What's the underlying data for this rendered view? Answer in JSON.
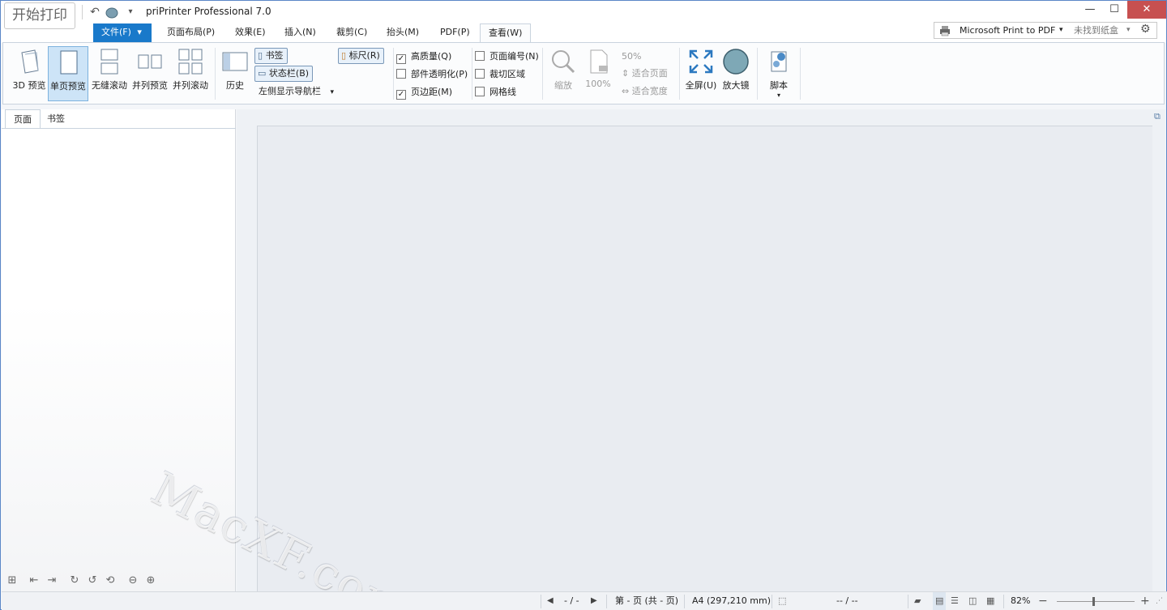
{
  "titlebar": {
    "start_print": "开始打印",
    "app_title": "priPrinter Professional 7.0",
    "undo_icon": "↶",
    "qat_dropdown_icon": "▾",
    "minimize_icon": "—",
    "maximize_icon": "☐",
    "close_icon": "✕"
  },
  "tabs": {
    "file": "文件(F)",
    "file_arrow": "▾",
    "page_layout": "页面布局(P)",
    "effects": "效果(E)",
    "insert": "插入(N)",
    "crop": "裁剪(C)",
    "header": "抬头(M)",
    "pdf": "PDF(P)",
    "view": "查看(W)"
  },
  "printer": {
    "name": "Microsoft Print to PDF",
    "tray": "未找到纸盒",
    "dropdown_icon": "▾",
    "settings_icon": "⚙"
  },
  "ribbon": {
    "preview_3d": "3D 预览",
    "single_page": "单页预览",
    "seamless_scroll": "无缝滚动",
    "side_by_side": "并列预览",
    "side_scroll": "并列滚动",
    "history": "历史",
    "bookmarks": "书签",
    "statusbar": "状态栏(B)",
    "left_nav": "左侧显示导航栏",
    "left_nav_arrow": "▾",
    "ruler": "标尺(R)",
    "high_quality": "高质量(Q)",
    "part_transparency": "部件透明化(P)",
    "margins": "页边距(M)",
    "page_numbers": "页面编号(N)",
    "crop_area": "裁切区域",
    "grid_lines": "网格线",
    "check_mark": "✓",
    "zoom": "缩放",
    "zoom_100": "100%",
    "zoom_50": "50%",
    "fit_page": "适合页面",
    "fit_width": "适合宽度",
    "fullscreen": "全屏(U)",
    "magnifier": "放大镜",
    "script": "脚本",
    "script_arrow": "▾"
  },
  "left_panel": {
    "tab_pages": "页面",
    "tab_bookmarks": "书签"
  },
  "watermark": "MacXF.com",
  "statusbar": {
    "page_nav": "- / -",
    "page_info": "第 - 页 (共 - 页)",
    "paper": "A4 (297,210 mm)",
    "position": "-- / --",
    "zoom": "82%",
    "zoom_minus": "−",
    "zoom_plus": "+",
    "prev_icon": "◀",
    "next_icon": "▶"
  }
}
